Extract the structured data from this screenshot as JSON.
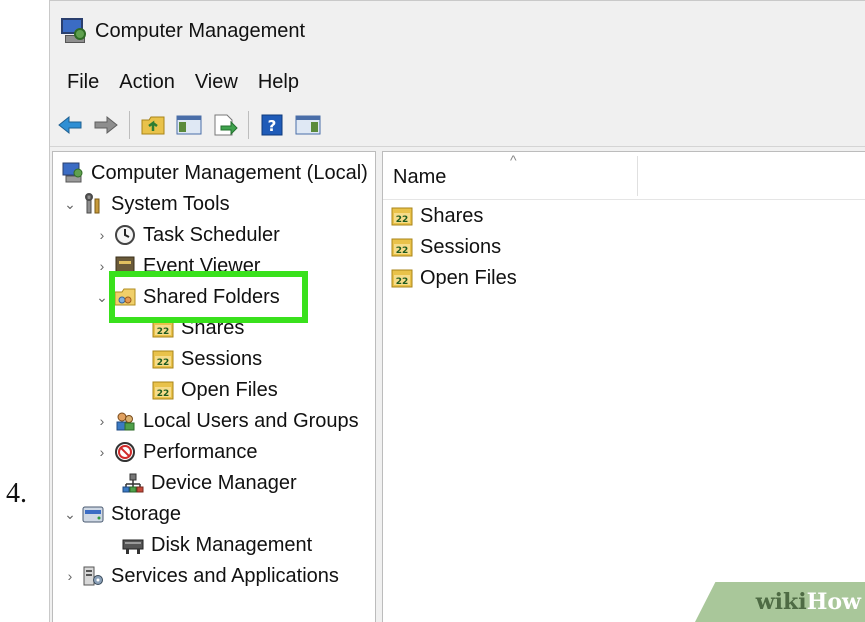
{
  "step_number": "4.",
  "window": {
    "title": "Computer Management"
  },
  "menu": [
    "File",
    "Action",
    "View",
    "Help"
  ],
  "toolbar": {
    "buttons": [
      "back-arrow-icon",
      "forward-arrow-icon",
      "up-folder-icon",
      "show-hide-tree-icon",
      "export-list-icon",
      "help-icon",
      "show-hide-action-pane-icon"
    ]
  },
  "tree": {
    "root": "Computer Management (Local)",
    "system_tools": "System Tools",
    "task_scheduler": "Task Scheduler",
    "event_viewer": "Event Viewer",
    "shared_folders": "Shared Folders",
    "shares": "Shares",
    "sessions": "Sessions",
    "open_files": "Open Files",
    "local_users": "Local Users and Groups",
    "performance": "Performance",
    "device_manager": "Device Manager",
    "storage": "Storage",
    "disk_management": "Disk Management",
    "services": "Services and Applications"
  },
  "list": {
    "column_name": "Name",
    "items": [
      "Shares",
      "Sessions",
      "Open Files"
    ]
  },
  "watermark": {
    "part1": "wiki",
    "part2": "How"
  },
  "colors": {
    "highlight": "#39e11c",
    "watermark_bg": "#a9c79a"
  }
}
